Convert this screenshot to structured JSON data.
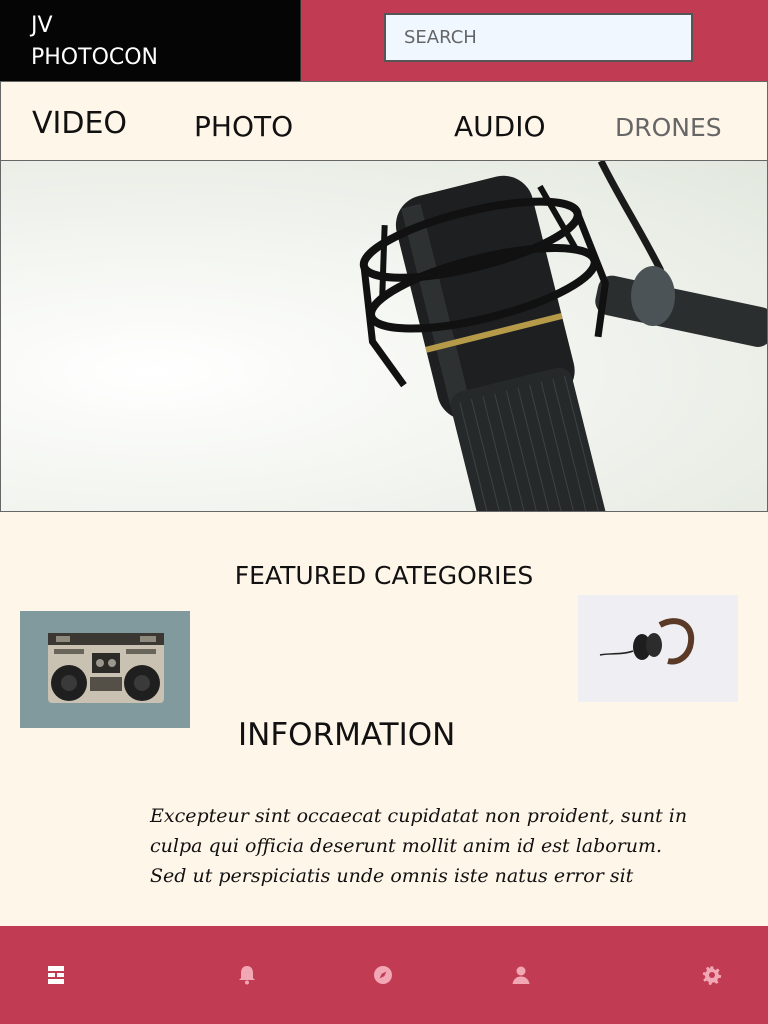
{
  "brand": {
    "line1": "JV",
    "line2": "PHOTOCON"
  },
  "search": {
    "placeholder": "SEARCH"
  },
  "nav": {
    "items": [
      {
        "label": "VIDEO"
      },
      {
        "label": "PHOTO"
      },
      {
        "label": "AUDIO"
      },
      {
        "label": "DRONES"
      }
    ]
  },
  "sections": {
    "featured_title": "FEATURED CATEGORIES",
    "info_title": "INFORMATION",
    "info_lines": [
      "Excepteur sint occaecat cupidatat non proident, sunt in",
      "culpa qui officia deserunt mollit anim id est laborum.",
      "Sed ut perspiciatis unde omnis iste natus error sit"
    ]
  },
  "hero": {
    "image": "microphone-photo"
  },
  "thumbnails": [
    {
      "image": "boombox-photo"
    },
    {
      "image": "headphones-photo"
    }
  ],
  "bottom_tabs": [
    {
      "icon": "dashboard-icon"
    },
    {
      "icon": "bell-icon"
    },
    {
      "icon": "compass-icon"
    },
    {
      "icon": "person-icon"
    },
    {
      "icon": "gear-icon"
    }
  ],
  "colors": {
    "accent": "#c13b53",
    "background": "#fff6ea",
    "logo_bg": "#050505",
    "active_tab": "#ffffff",
    "inactive_tab": "#f2a7b5"
  }
}
